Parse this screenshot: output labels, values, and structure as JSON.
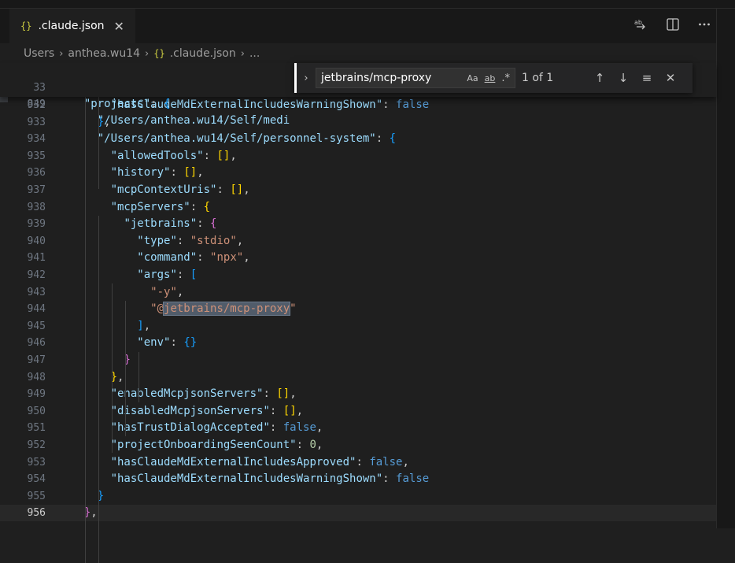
{
  "tab": {
    "brace": "{}",
    "name": ".claude.json",
    "close": "✕"
  },
  "actions": [
    "compare-icon",
    "split-editor-icon",
    "more-actions-icon"
  ],
  "breadcrumb": {
    "parts": [
      "Users",
      "anthea.wu14",
      ".claude.json",
      "..."
    ],
    "icon": "{}"
  },
  "find": {
    "query": "jetbrains/mcp-proxy",
    "match_case": "Aa",
    "whole_word": "ab",
    "regex": ".*",
    "count": "1 of 1"
  },
  "sticky": [
    {
      "num": "33",
      "text": "\"projects\": {"
    },
    {
      "num": "849",
      "text": "\"/Users/anthea.wu14/Self/medi"
    }
  ],
  "lines": [
    {
      "num": "932",
      "text": "\"hasClaudeMdExternalIncludesWarningShown\": false"
    },
    {
      "num": "933",
      "text": "},"
    },
    {
      "num": "934",
      "text": "\"/Users/anthea.wu14/Self/personnel-system\": {"
    },
    {
      "num": "935",
      "text": "\"allowedTools\": [],"
    },
    {
      "num": "936",
      "text": "\"history\": [],"
    },
    {
      "num": "937",
      "text": "\"mcpContextUris\": [],"
    },
    {
      "num": "938",
      "text": "\"mcpServers\": {"
    },
    {
      "num": "939",
      "text": "\"jetbrains\": {"
    },
    {
      "num": "940",
      "text": "\"type\": \"stdio\","
    },
    {
      "num": "941",
      "text": "\"command\": \"npx\","
    },
    {
      "num": "942",
      "text": "\"args\": ["
    },
    {
      "num": "943",
      "text": "\"-y\","
    },
    {
      "num": "944",
      "text": "\"@jetbrains/mcp-proxy\""
    },
    {
      "num": "945",
      "text": "],"
    },
    {
      "num": "946",
      "text": "\"env\": {}"
    },
    {
      "num": "947",
      "text": "}"
    },
    {
      "num": "948",
      "text": "},"
    },
    {
      "num": "949",
      "text": "\"enabledMcpjsonServers\": [],"
    },
    {
      "num": "950",
      "text": "\"disabledMcpjsonServers\": [],"
    },
    {
      "num": "951",
      "text": "\"hasTrustDialogAccepted\": false,"
    },
    {
      "num": "952",
      "text": "\"projectOnboardingSeenCount\": 0,"
    },
    {
      "num": "953",
      "text": "\"hasClaudeMdExternalIncludesApproved\": false,"
    },
    {
      "num": "954",
      "text": "\"hasClaudeMdExternalIncludesWarningShown\": false"
    },
    {
      "num": "955",
      "text": "}"
    },
    {
      "num": "956",
      "text": "},"
    }
  ],
  "colors": {
    "background": "#1f1f1f",
    "key": "#9cdcfe",
    "string": "#ce9178",
    "bracket_level1": "#ffd700",
    "bracket_level2": "#da70d6",
    "bracket_level3": "#179fff",
    "keyword": "#569cd6",
    "number": "#b5cea8"
  }
}
